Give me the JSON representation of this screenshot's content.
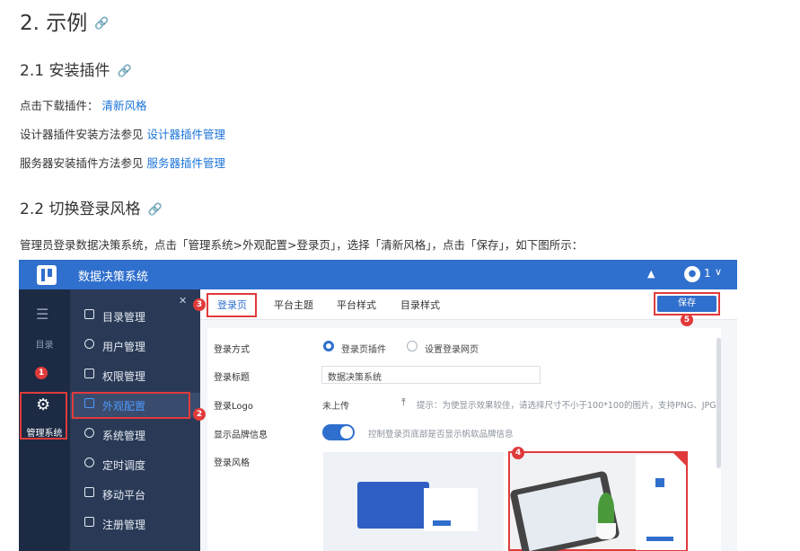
{
  "doc": {
    "h2": "2. 示例",
    "h3_install": "2.1 安装插件",
    "p_download_prefix": "点击下载插件：",
    "p_download_link": "清新风格",
    "p_designer_prefix": "设计器插件安装方法参见",
    "p_designer_link": "设计器插件管理",
    "p_server_prefix": "服务器安装插件方法参见",
    "p_server_link": "服务器插件管理",
    "h3_switch": "2.2 切换登录风格",
    "p_instruction": "管理员登录数据决策系统，点击「管理系统>外观配置>登录页」，选择「清新风格」，点击「保存」，如下图所示：",
    "anchor_icon": "link-icon"
  },
  "screenshot": {
    "app_title": "数据决策系统",
    "user_count": "1",
    "leftbar": {
      "catalog_label": "目录",
      "admin_label": "管理系统"
    },
    "nav_items": [
      "目录管理",
      "用户管理",
      "权限管理",
      "外观配置",
      "系统管理",
      "定时调度",
      "移动平台",
      "注册管理"
    ],
    "tabs": [
      "登录页",
      "平台主题",
      "平台样式",
      "目录样式"
    ],
    "save_label": "保存",
    "form": {
      "login_mode_label": "登录方式",
      "option_plugin": "登录页插件",
      "option_web": "设置登录网页",
      "login_title_label": "登录标题",
      "login_title_value": "数据决策系统",
      "logo_label": "登录Logo",
      "logo_value": "未上传",
      "logo_hint": "提示：为使显示效果较佳，请选择尺寸不小于100*100的图片，支持PNG、JPG",
      "brand_label": "显示品牌信息",
      "brand_hint": "控制登录页底部是否显示帆软品牌信息",
      "style_label": "登录风格"
    },
    "badges": [
      "1",
      "2",
      "3",
      "4",
      "5"
    ],
    "colors": {
      "topbar": "#2f6fcd",
      "sidebar": "#1c2a44",
      "nav": "#2a3a56",
      "highlight": "#e03b3b",
      "link": "#1a73d9"
    }
  }
}
